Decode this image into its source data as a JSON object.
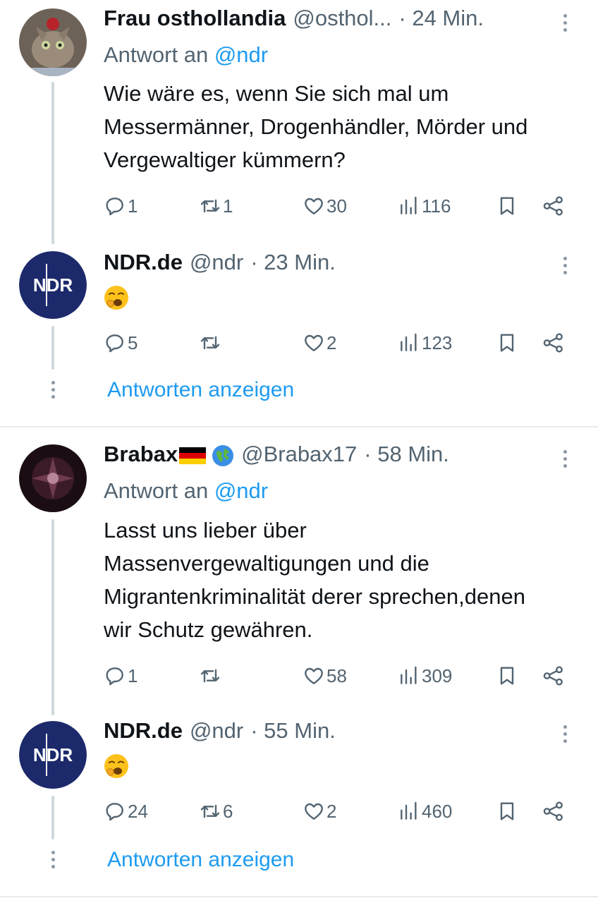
{
  "tweets": [
    {
      "name": "Frau osthollandia",
      "handle": "@osthol...",
      "time": "· 24 Min.",
      "reply_prefix": "Antwort an",
      "reply_mention": "@ndr",
      "text": "Wie wäre es, wenn Sie sich mal um Messermänner, Drogenhändler, Mörder und Vergewaltiger kümmern?",
      "replies": "1",
      "retweets": "1",
      "likes": "30",
      "views": "116"
    },
    {
      "name": "NDR.de",
      "handle": "@ndr",
      "time": "· 23 Min.",
      "avatar_text": "NDR",
      "emoji_icon": "yawning-face-icon",
      "replies": "5",
      "retweets": "",
      "likes": "2",
      "views": "123",
      "show_replies": "Antworten anzeigen"
    },
    {
      "name": "Brabax",
      "handle": "@Brabax17",
      "time": "· 58 Min.",
      "name_icons": [
        "german-flag-icon",
        "globe-icon"
      ],
      "reply_prefix": "Antwort an",
      "reply_mention": "@ndr",
      "text": "Lasst uns lieber über Massenvergewaltigungen und die Migrantenkriminalität derer sprechen,denen wir Schutz gewähren.",
      "replies": "1",
      "retweets": "",
      "likes": "58",
      "views": "309"
    },
    {
      "name": "NDR.de",
      "handle": "@ndr",
      "time": "· 55 Min.",
      "avatar_text": "NDR",
      "emoji_icon": "yawning-face-icon",
      "replies": "24",
      "retweets": "6",
      "likes": "2",
      "views": "460",
      "show_replies": "Antworten anzeigen"
    }
  ],
  "colors": {
    "text": "#0f1419",
    "secondary": "#536471",
    "accent": "#1d9bf0",
    "ndr_blue": "#1c2a6b"
  }
}
